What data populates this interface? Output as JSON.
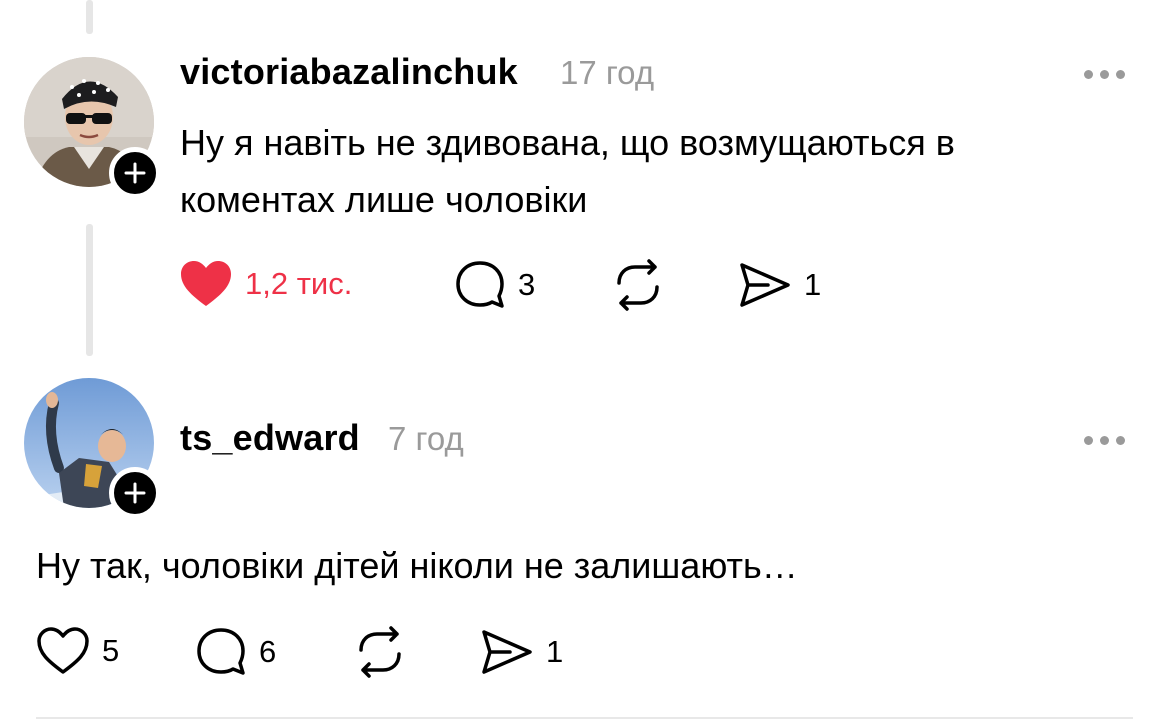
{
  "posts": [
    {
      "username": "victoriabazalinchuk",
      "time": "17 год",
      "text_lines": [
        "Ну я навіть не здивована, що возмущаються в",
        "коментах лише чоловіки"
      ],
      "liked": true,
      "likes": "1,2 тис.",
      "replies": "3",
      "shares": "1",
      "like_color": "#ee3147"
    },
    {
      "username": "ts_edward",
      "time": "7 год",
      "text_lines": [
        "Ну так, чоловіки дітей ніколи не залишають…"
      ],
      "liked": false,
      "likes": "5",
      "replies": "6",
      "shares": "1"
    }
  ],
  "icons": {
    "follow": "plus-icon",
    "menu": "more-dots-icon",
    "like": "heart-icon",
    "reply": "comment-icon",
    "repost": "repost-icon",
    "share": "send-icon"
  }
}
